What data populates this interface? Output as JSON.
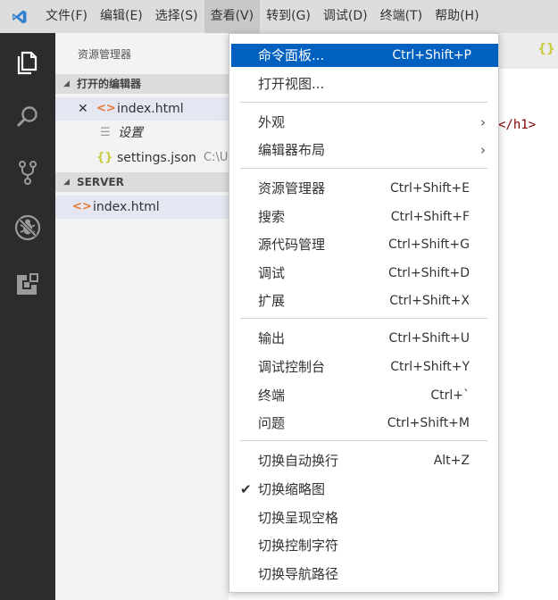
{
  "menubar": {
    "items": [
      {
        "label": "文件(F)"
      },
      {
        "label": "编辑(E)"
      },
      {
        "label": "选择(S)"
      },
      {
        "label": "查看(V)",
        "active": true
      },
      {
        "label": "转到(G)"
      },
      {
        "label": "调试(D)"
      },
      {
        "label": "终端(T)"
      },
      {
        "label": "帮助(H)"
      }
    ]
  },
  "activity_bar": {
    "icons": [
      "files-icon",
      "search-icon",
      "source-control-icon",
      "debug-icon",
      "extensions-icon"
    ]
  },
  "sidebar": {
    "title": "资源管理器",
    "open_editors": {
      "header": "打开的编辑器",
      "items": [
        {
          "name": "index.html",
          "close_glyph": "✕",
          "icon": "html-file-icon"
        },
        {
          "name": "设置",
          "icon": "settings-file-icon"
        },
        {
          "name": "settings.json",
          "path": "C:\\U",
          "icon": "json-file-icon"
        }
      ]
    },
    "server": {
      "header": "SERVER",
      "items": [
        {
          "name": "index.html",
          "icon": "html-file-icon"
        }
      ]
    }
  },
  "editor": {
    "code_visible": "</h1>"
  },
  "view_menu": {
    "groups": [
      [
        {
          "label": "命令面板...",
          "shortcut": "Ctrl+Shift+P",
          "highlighted": true
        },
        {
          "label": "打开视图...",
          "shortcut": ""
        }
      ],
      [
        {
          "label": "外观",
          "submenu": true
        },
        {
          "label": "编辑器布局",
          "submenu": true
        }
      ],
      [
        {
          "label": "资源管理器",
          "shortcut": "Ctrl+Shift+E"
        },
        {
          "label": "搜索",
          "shortcut": "Ctrl+Shift+F"
        },
        {
          "label": "源代码管理",
          "shortcut": "Ctrl+Shift+G"
        },
        {
          "label": "调试",
          "shortcut": "Ctrl+Shift+D"
        },
        {
          "label": "扩展",
          "shortcut": "Ctrl+Shift+X"
        }
      ],
      [
        {
          "label": "输出",
          "shortcut": "Ctrl+Shift+U"
        },
        {
          "label": "调试控制台",
          "shortcut": "Ctrl+Shift+Y"
        },
        {
          "label": "终端",
          "shortcut": "Ctrl+`"
        },
        {
          "label": "问题",
          "shortcut": "Ctrl+Shift+M"
        }
      ],
      [
        {
          "label": "切换自动换行",
          "shortcut": "Alt+Z"
        },
        {
          "label": "切换缩略图",
          "shortcut": "",
          "checked": true
        },
        {
          "label": "切换呈现空格",
          "shortcut": ""
        },
        {
          "label": "切换控制字符",
          "shortcut": ""
        },
        {
          "label": "切换导航路径",
          "shortcut": ""
        }
      ]
    ]
  },
  "colors": {
    "accent": "#0060c0",
    "activity_bar": "#2c2c2c",
    "menubar": "#dddddd",
    "logo": "#2f80cf"
  }
}
